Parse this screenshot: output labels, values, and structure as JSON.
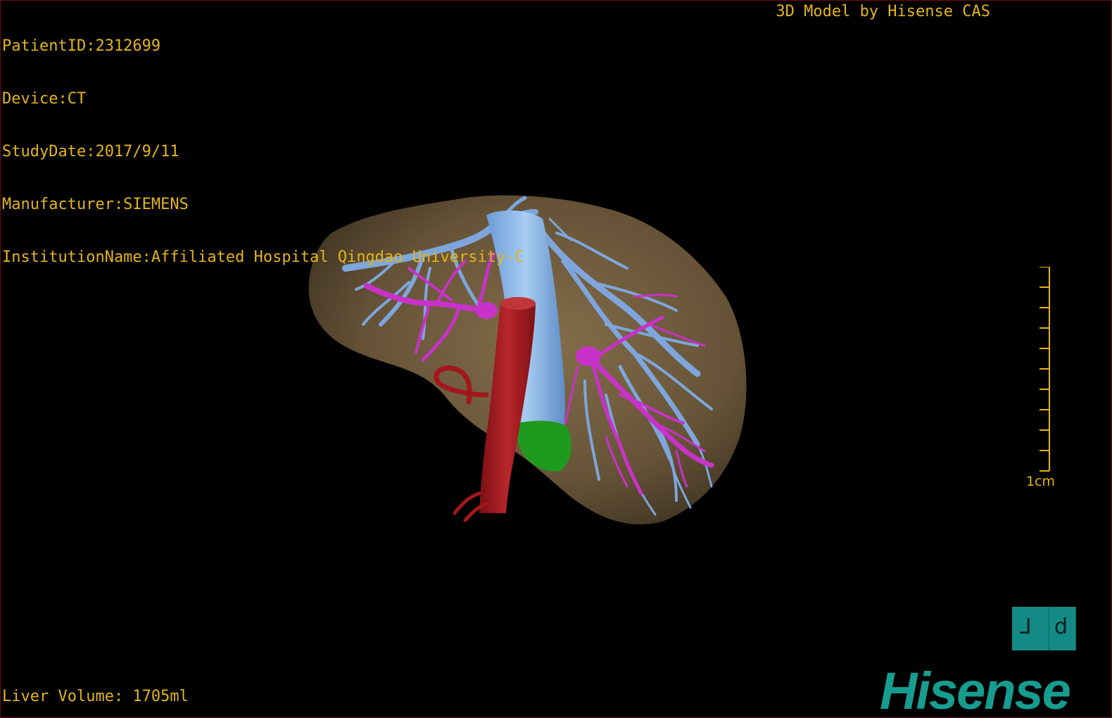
{
  "metadata": {
    "patient_id": "PatientID:2312699",
    "device": "Device:CT",
    "study_date": "StudyDate:2017/9/11",
    "manufacturer": "Manufacturer:SIEMENS",
    "institution": "InstitutionName:Affiliated Hospital Qingdao University-C"
  },
  "brand_caption": "3D Model by Hisense CAS",
  "volume_readout": "Liver Volume: 1705ml",
  "scale_bar": {
    "label": "1cm",
    "divisions": 10
  },
  "orientation_cube": {
    "left_face": "⅃",
    "right_face": "d"
  },
  "logo": "Hisense",
  "colors": {
    "overlay_text": "#e3b51a",
    "liver": "#6e5b3c",
    "hepatic_vein": "#7ea6dc",
    "portal_vein": "#c832c8",
    "vena_cava": "#8cb8ea",
    "aorta": "#a3171c",
    "gallbladder": "#1e9a1e",
    "logo": "#179d8f"
  }
}
